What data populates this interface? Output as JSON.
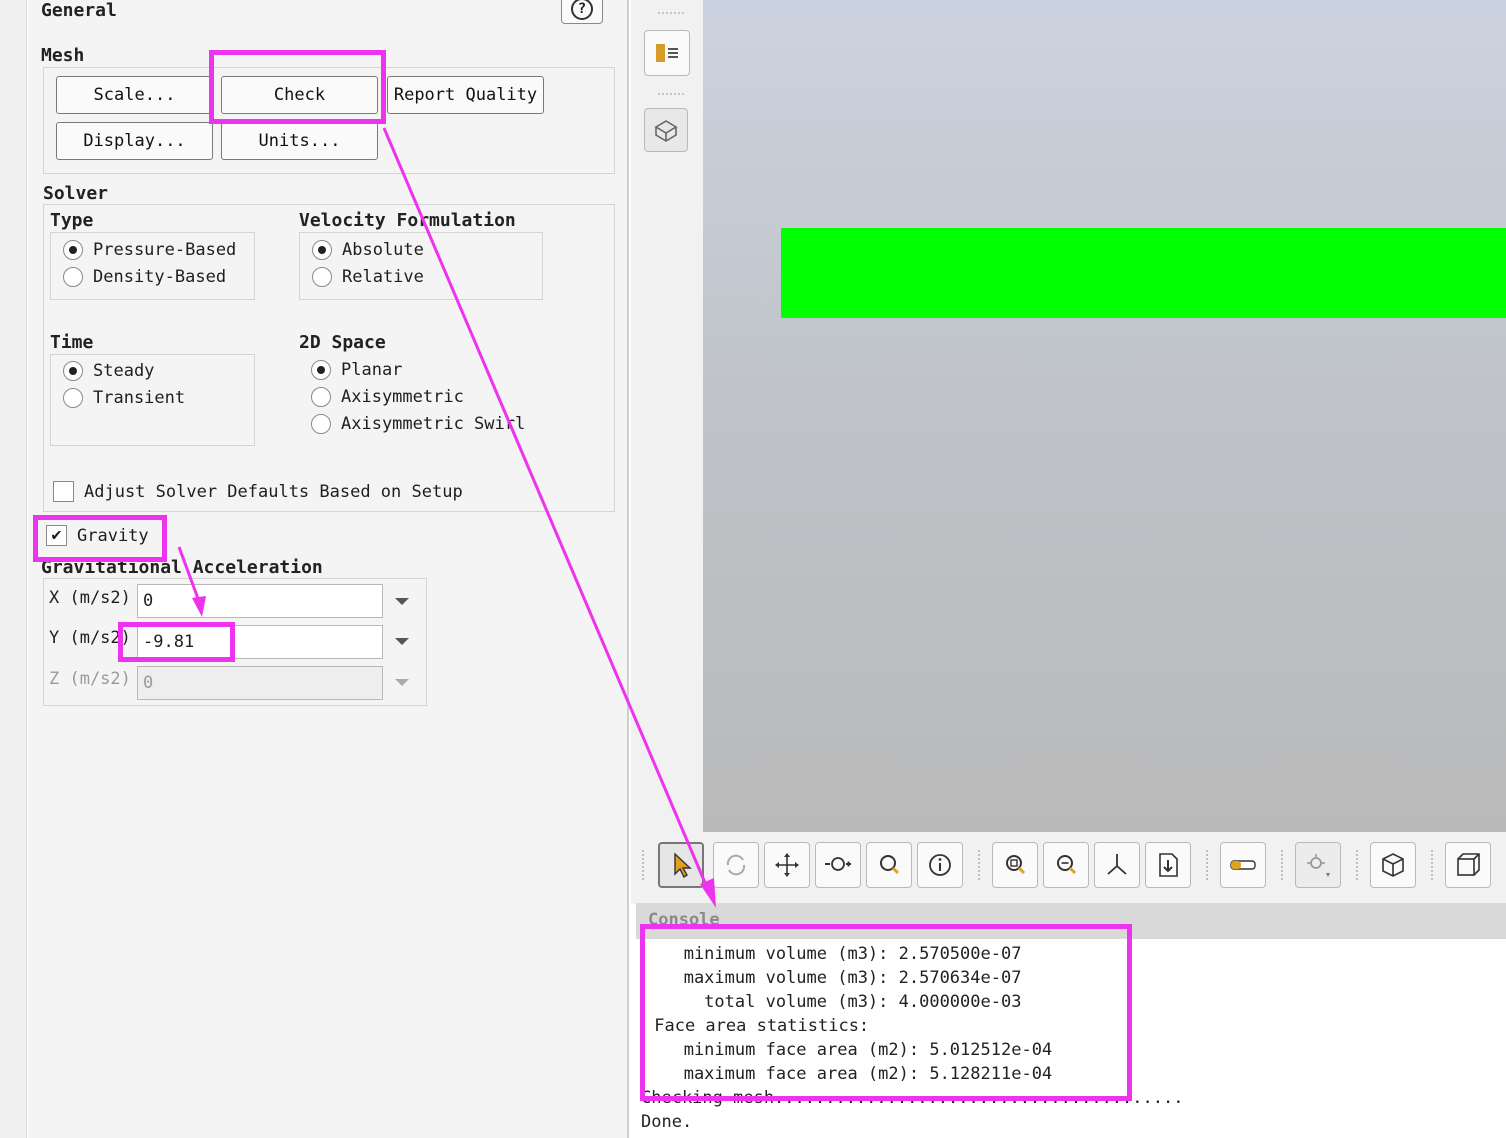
{
  "general": {
    "title": "General",
    "help_icon": "help-icon"
  },
  "mesh": {
    "title": "Mesh",
    "scale_label": "Scale...",
    "check_label": "Check",
    "report_quality_label": "Report Quality",
    "display_label": "Display...",
    "units_label": "Units..."
  },
  "solver": {
    "title": "Solver",
    "type": {
      "label": "Type",
      "options": [
        "Pressure-Based",
        "Density-Based"
      ],
      "selected": "Pressure-Based"
    },
    "velocity": {
      "label": "Velocity Formulation",
      "options": [
        "Absolute",
        "Relative"
      ],
      "selected": "Absolute"
    },
    "time": {
      "label": "Time",
      "options": [
        "Steady",
        "Transient"
      ],
      "selected": "Steady"
    },
    "space": {
      "label": "2D Space",
      "options": [
        "Planar",
        "Axisymmetric",
        "Axisymmetric Swirl"
      ],
      "selected": "Planar"
    },
    "adjust_label": "Adjust Solver Defaults Based on Setup",
    "adjust_checked": false
  },
  "gravity": {
    "label": "Gravity",
    "checked": true,
    "accel_title": "Gravitational Acceleration",
    "x_label": "X (m/s2)",
    "x_value": "0",
    "y_label": "Y (m/s2)",
    "y_value": "-9.81",
    "z_label": "Z (m/s2)",
    "z_value": "0"
  },
  "viewport": {
    "mesh_color": "#00ff00"
  },
  "toolbar": {
    "icons": [
      "select-arrow-icon",
      "rotate-icon",
      "pan-icon",
      "zoom-in-out-icon",
      "zoom-icon",
      "probe-info-icon",
      "zoom-to-fit-icon",
      "zoom-box-icon",
      "axes-icon",
      "save-picture-icon",
      "ruler-icon",
      "lights-icon",
      "isometric-view-icon",
      "view-cube-icon"
    ]
  },
  "console": {
    "title": "Console",
    "lines": [
      "   minimum volume (m3): 2.570500e-07",
      "   maximum volume (m3): 2.570634e-07",
      "     total volume (m3): 4.000000e-03",
      " Face area statistics:",
      "   minimum face area (m2): 5.012512e-04",
      "   maximum face area (m2): 5.128211e-04",
      "Checking mesh........................................",
      "Done."
    ]
  },
  "annotation_color": "#ee33ee"
}
